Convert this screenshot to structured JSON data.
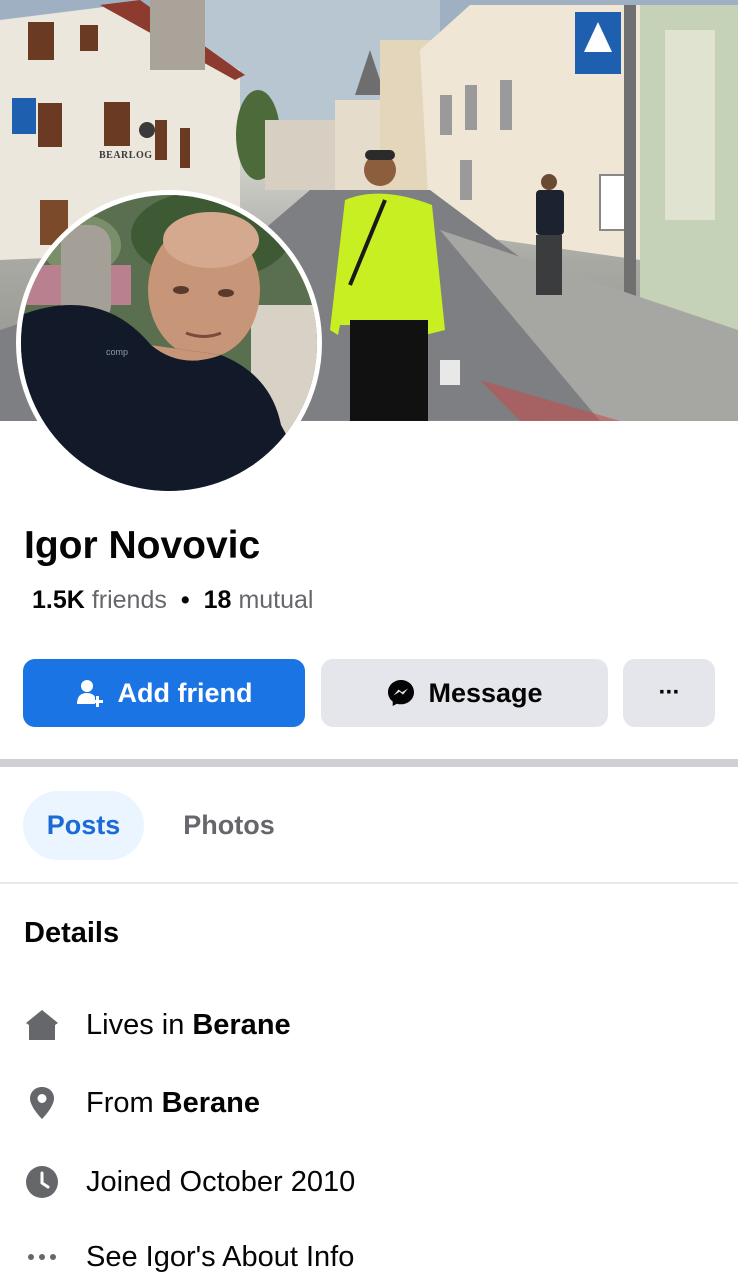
{
  "cover": {
    "sign_text": "BEARLOG"
  },
  "profile": {
    "name": "Igor Novovic",
    "friends_count": "1.5K",
    "friends_label": "friends",
    "separator": "•",
    "mutual_count": "18",
    "mutual_label": "mutual"
  },
  "actions": {
    "add_friend_label": "Add friend",
    "message_label": "Message",
    "more_label": "···"
  },
  "tabs": [
    {
      "label": "Posts",
      "active": true
    },
    {
      "label": "Photos",
      "active": false
    }
  ],
  "details": {
    "title": "Details",
    "items": [
      {
        "icon": "home-icon",
        "prefix": "Lives in",
        "value": "Berane"
      },
      {
        "icon": "location-pin-icon",
        "prefix": "From",
        "value": "Berane"
      },
      {
        "icon": "clock-icon",
        "prefix": "Joined October 2010",
        "value": ""
      },
      {
        "icon": "more-dots-icon",
        "prefix": "See Igor's About Info",
        "value": ""
      }
    ]
  },
  "colors": {
    "accent": "#1b74e4",
    "button_gray": "#e4e6eb",
    "tab_active_bg": "#ebf5ff",
    "muted_text": "#65676b"
  }
}
